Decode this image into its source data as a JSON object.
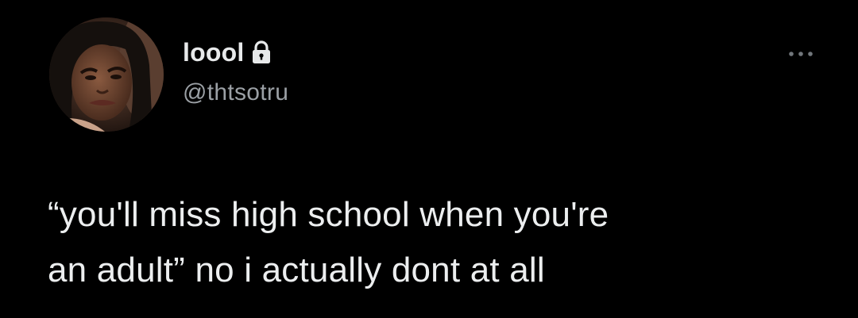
{
  "tweet": {
    "display_name": "loool",
    "handle": "@thtsotru",
    "text_line1": "“you'll miss high school when you're",
    "text_line2": "an adult” no i actually dont at all",
    "protected_icon": "lock-icon",
    "more_icon": "more-horizontal-icon"
  },
  "colors": {
    "background": "#000000",
    "primary_text": "#e7e9ea",
    "secondary_text": "#9ba0a5"
  }
}
